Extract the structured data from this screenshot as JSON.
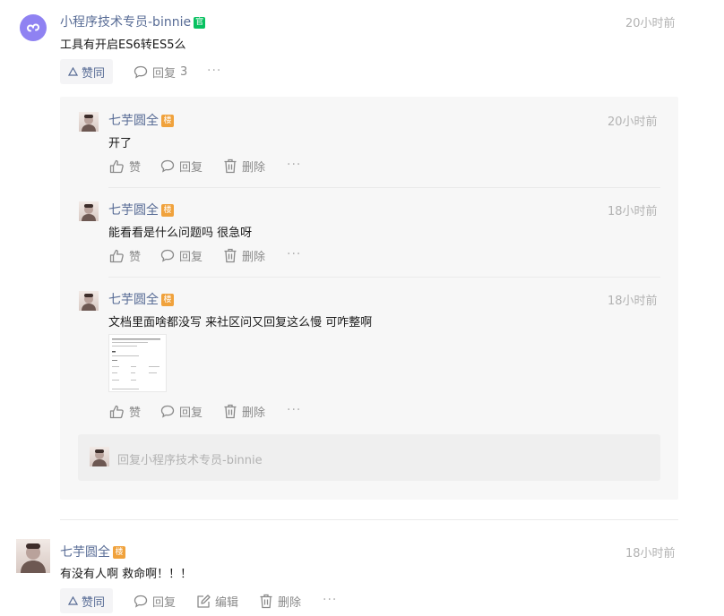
{
  "comment1": {
    "author": "小程序技术专员-binnie",
    "badge": "官",
    "time": "20小时前",
    "text": "工具有开启ES6转ES5么",
    "actions": {
      "like": "赞同",
      "reply": "回复",
      "reply_count": "3",
      "more": "···"
    }
  },
  "replies": [
    {
      "author": "七芋圆全",
      "badge": "楼",
      "time": "20小时前",
      "text": "开了",
      "actions": {
        "like": "赞",
        "reply": "回复",
        "delete": "删除",
        "more": "···"
      }
    },
    {
      "author": "七芋圆全",
      "badge": "楼",
      "time": "18小时前",
      "text": "能看看是什么问题吗 很急呀",
      "actions": {
        "like": "赞",
        "reply": "回复",
        "delete": "删除",
        "more": "···"
      }
    },
    {
      "author": "七芋圆全",
      "badge": "楼",
      "time": "18小时前",
      "text": "文档里面啥都没写 来社区问又回复这么慢 可咋整啊",
      "actions": {
        "like": "赞",
        "reply": "回复",
        "delete": "删除",
        "more": "···"
      }
    }
  ],
  "reply_input": {
    "placeholder": "回复小程序技术专员-binnie"
  },
  "comment2": {
    "author": "七芋圆全",
    "badge": "楼",
    "time": "18小时前",
    "text": "有没有人啊 救命啊！！！",
    "actions": {
      "like": "赞同",
      "reply": "回复",
      "edit": "编辑",
      "delete": "删除",
      "more": "···"
    }
  },
  "colors": {
    "link": "#576b95",
    "official_badge": "#07c160",
    "floor_badge": "#f0a23c",
    "avatar_bg": "#8f82f2"
  },
  "icons": [
    "miniprogram-logo-icon",
    "like-triangle-icon",
    "thumbs-up-icon",
    "comment-bubble-icon",
    "trash-icon",
    "edit-icon",
    "more-icon"
  ]
}
